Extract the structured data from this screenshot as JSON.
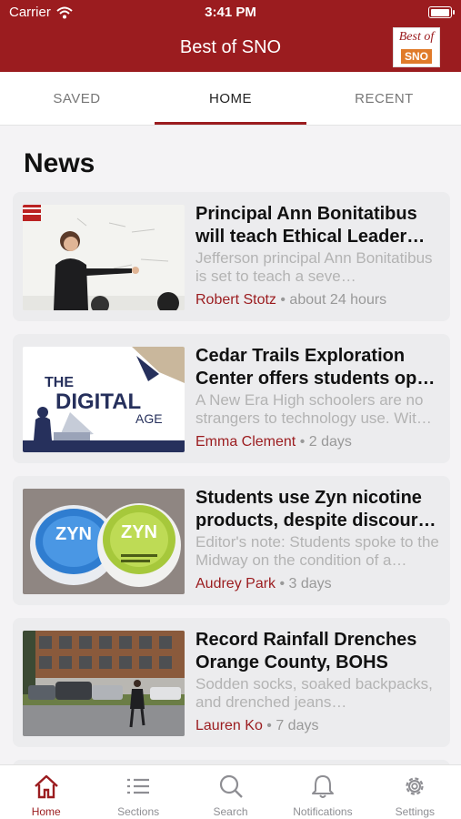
{
  "status_bar": {
    "carrier": "Carrier",
    "time": "3:41 PM"
  },
  "nav": {
    "title": "Best of SNO",
    "logo_line1": "Best of",
    "logo_line2": "SNO"
  },
  "tabs": [
    {
      "label": "SAVED",
      "active": false
    },
    {
      "label": "HOME",
      "active": true
    },
    {
      "label": "RECENT",
      "active": false
    }
  ],
  "section_title": "News",
  "articles": [
    {
      "headline": "Principal Ann Bonitatibus will teach Ethical Leader…",
      "summary": "Jefferson principal Ann Bonitatibus is set to teach a seve…",
      "author": "Robert Stotz",
      "time": " • about 24 hours",
      "thumb": "teacher-whiteboard"
    },
    {
      "headline": "Cedar Trails Exploration Center offers students op…",
      "summary": "A New Era High schoolers are no strangers to technology use. Wit…",
      "author": "Emma Clement",
      "time": " • 2 days",
      "thumb": "digital-age-illustration",
      "thumb_text": {
        "the": "THE",
        "digital": "DIGITAL",
        "age": "AGE"
      }
    },
    {
      "headline": "Students use Zyn nicotine products, despite discour…",
      "summary": "Editor's note: Students spoke to the Midway on the condition of a…",
      "author": "Audrey Park",
      "time": " • 3 days",
      "thumb": "zyn-tins",
      "thumb_text": {
        "brand": "ZYN"
      }
    },
    {
      "headline": "Record Rainfall Drenches Orange County, BOHS",
      "summary": "Sodden socks, soaked backpacks, and drenched jeans…",
      "author": "Lauren Ko",
      "time": " • 7 days",
      "thumb": "rainy-parking-lot"
    }
  ],
  "tabbar": [
    {
      "label": "Home",
      "icon": "home-icon",
      "active": true
    },
    {
      "label": "Sections",
      "icon": "list-icon",
      "active": false
    },
    {
      "label": "Search",
      "icon": "search-icon",
      "active": false
    },
    {
      "label": "Notifications",
      "icon": "bell-icon",
      "active": false
    },
    {
      "label": "Settings",
      "icon": "gear-icon",
      "active": false
    }
  ],
  "colors": {
    "brand": "#9b1c1f",
    "accent_orange": "#e07b2a"
  }
}
